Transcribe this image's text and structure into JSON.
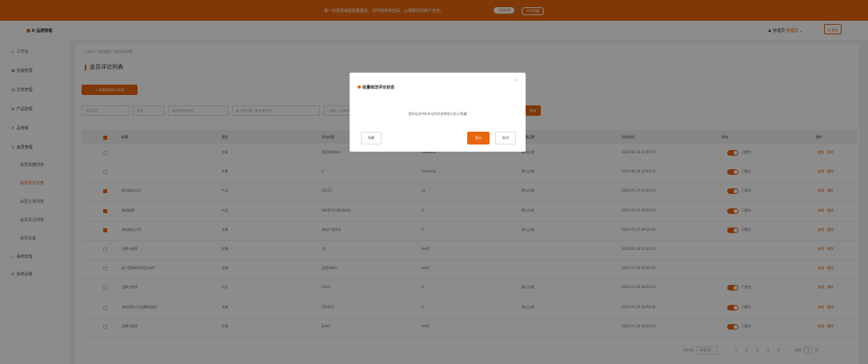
{
  "announcement": {
    "text": "第一次登录或密码重置后，请尽快修改密码，以保障您的账户安全。",
    "btn_primary": "立即修改",
    "btn_secondary": "不再提醒"
  },
  "header": {
    "logo": "E·品牌管理",
    "user": "管理员",
    "role": "管理员",
    "logout": "退出"
  },
  "sidebar": {
    "items": [
      {
        "icon": "home-icon",
        "glyph": "⌂",
        "label": "工作台"
      },
      {
        "icon": "store-icon",
        "glyph": "▣",
        "label": "店铺管理"
      },
      {
        "icon": "doc-icon",
        "glyph": "▤",
        "label": "文章管理"
      },
      {
        "icon": "product-icon",
        "glyph": "◈",
        "label": "产品管理"
      },
      {
        "icon": "brand-icon",
        "glyph": "✦",
        "label": "品牌库"
      },
      {
        "icon": "member-icon",
        "glyph": "♙",
        "label": "会员管理"
      },
      {
        "icon": "shield-icon",
        "glyph": "◇",
        "label": "系统管理"
      },
      {
        "icon": "gear-icon",
        "glyph": "⚙",
        "label": "系统设置"
      }
    ],
    "subitems": [
      "会员收藏列表",
      "会员评论列表",
      "会员订单列表",
      "会员关注列表",
      "会员设置"
    ]
  },
  "breadcrumb": "工作台 / 会员管理 / 会员评论列表",
  "page_title": "会员评论列表",
  "batch_button": "+ 批量修改评论状态",
  "filters": {
    "f1": "评论类型",
    "f2": "状态",
    "f3": "请选择关联商品",
    "d1": "开始日期",
    "d2": "结束日期",
    "kw": "请输入关键字",
    "query": "查询"
  },
  "table": {
    "headers": [
      "标题",
      "类型",
      "评论内容",
      "评论人",
      "所属品牌",
      "评论时间",
      "状态",
      "操作"
    ],
    "rows": [
      {
        "checked": false,
        "title": "",
        "type": "文章",
        "content": "测试测试test",
        "user": "huaxiaox",
        "brand": "默认分类",
        "time": "2022-04-18 21:05:17",
        "status": true
      },
      {
        "checked": false,
        "title": "",
        "type": "文章",
        "content": "1",
        "user": "huaxiaox",
        "brand": "默认分类",
        "time": "2022-04-18 20:53:54",
        "status": true
      },
      {
        "checked": true,
        "title": "测试商品公司",
        "type": "产品",
        "content": "12212",
        "user": "xx",
        "brand": "默认分类",
        "time": "2022-01-27 15:40:51",
        "status": true
      },
      {
        "checked": true,
        "title": "测试标题",
        "type": "产品",
        "content": "66661111测试好的",
        "user": "6",
        "brand": "默认分类",
        "time": "2022-01-27 09:25:54",
        "status": true
      },
      {
        "checked": true,
        "title": "测试商品公司",
        "type": "文章",
        "content": "测试产品评论",
        "user": "6",
        "brand": "默认分类",
        "time": "2022-01-27 09:21:05",
        "status": true
      },
      {
        "checked": false,
        "title": "品牌小程序",
        "type": "文章",
        "content": "11",
        "user": "test2",
        "brand": "",
        "time": "2022-01-26 23:12:11",
        "status": false
      },
      {
        "checked": false,
        "title": "这个是新的资讯怎么样?",
        "type": "文章",
        "content": "这是1q4ts",
        "user": "test2",
        "brand": "",
        "time": "2022-01-26 23:07:43",
        "status": false
      },
      {
        "checked": false,
        "title": "品牌小程序",
        "type": "产品",
        "content": "3333",
        "user": "6",
        "brand": "默认分类",
        "time": "2022-01-26 18:57:01",
        "status": true
      },
      {
        "checked": false,
        "title": "测试到第十次品牌名测试",
        "type": "文章",
        "content": "555555",
        "user": "6",
        "brand": "默认分类",
        "time": "2022-01-26 18:50:06",
        "status": true
      },
      {
        "checked": false,
        "title": "品牌小程序",
        "type": "文章",
        "content": "jbkbf",
        "user": "test2",
        "brand": "",
        "time": "2022-01-26 06:07:23",
        "status": true
      }
    ],
    "status_on": "已提交",
    "op_edit": "查看",
    "op_delete": "删除"
  },
  "pagination": {
    "total": "共10条",
    "per_page": "10条/页",
    "pages": [
      "1",
      "2",
      "3",
      "4",
      "5"
    ],
    "goto": "前往",
    "page_suffix": "页"
  },
  "modal": {
    "title": "批量修改评论状态",
    "message": "您所勾选中的评论的状态将改为显示/隐藏",
    "hide": "隐藏",
    "show": "显示",
    "cancel": "取消"
  },
  "colors": {
    "accent": "#e8660c"
  }
}
